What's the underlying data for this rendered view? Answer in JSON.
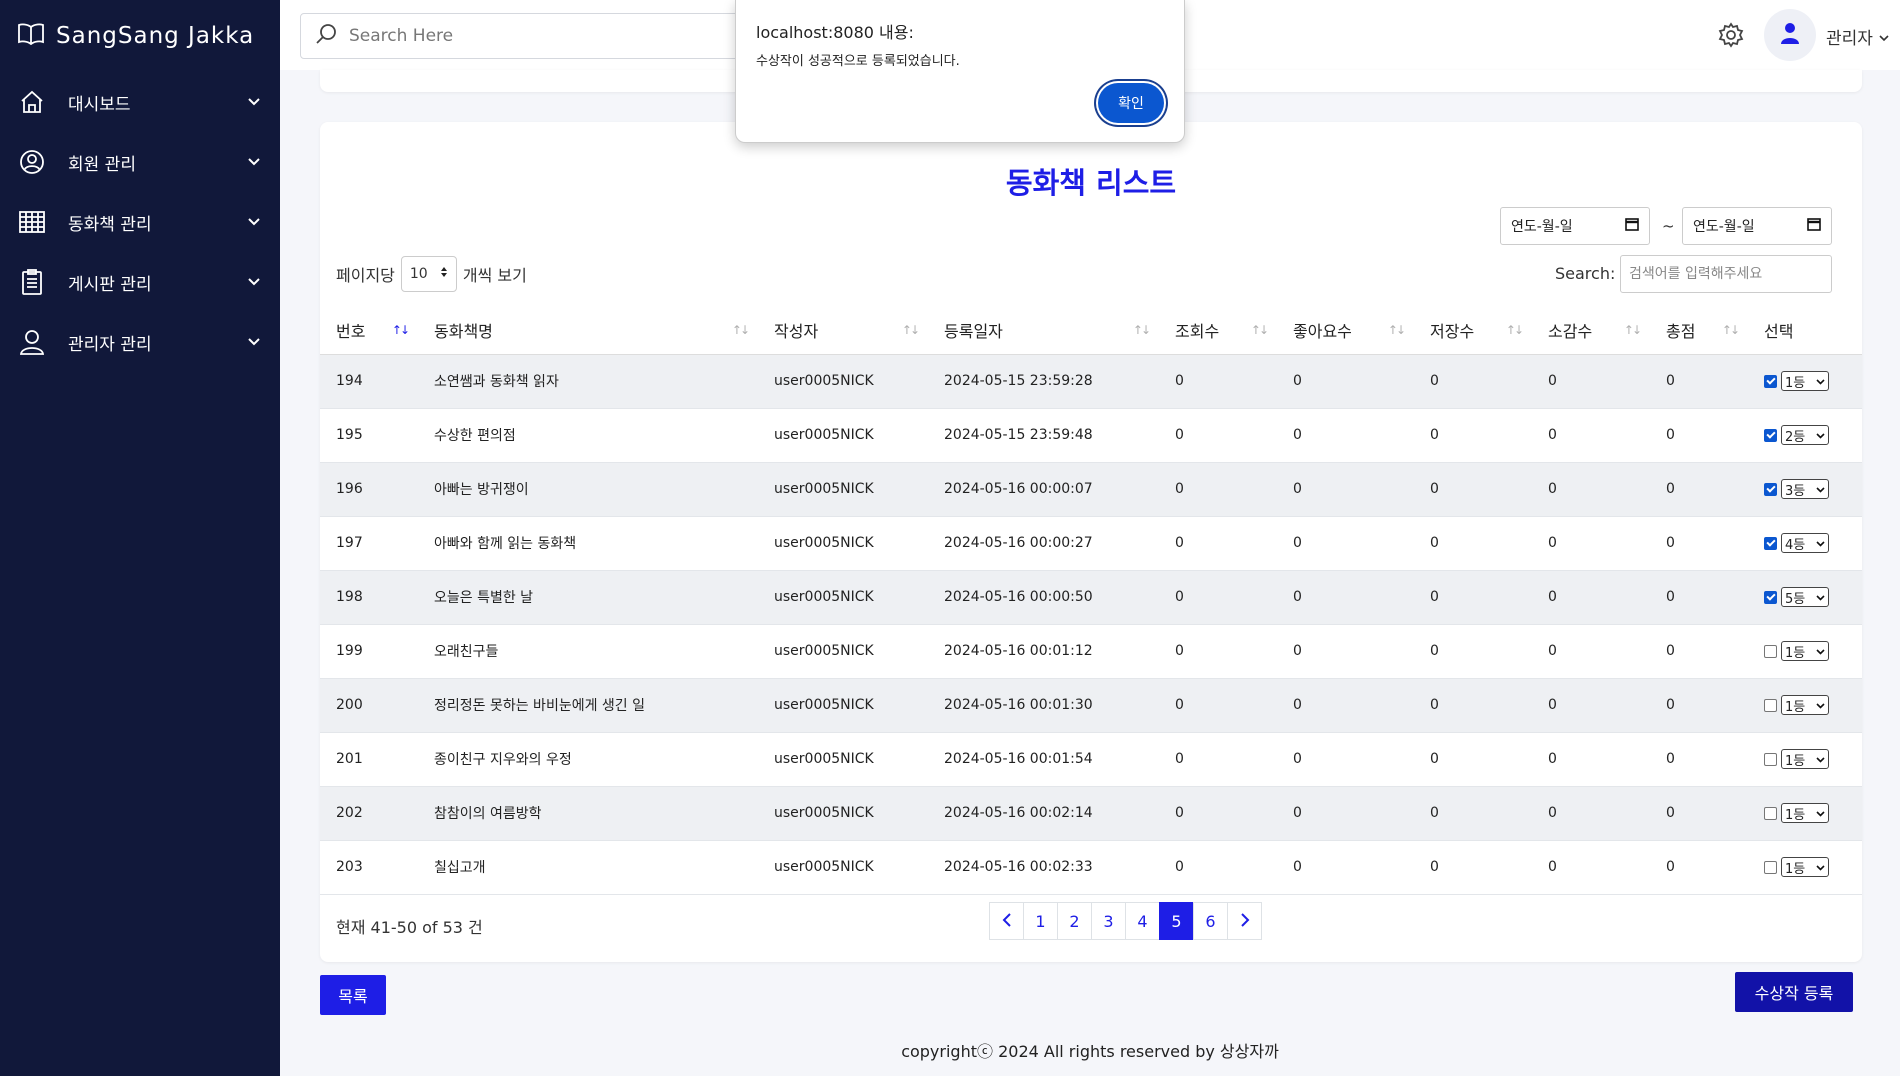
{
  "sidebar": {
    "brand": "SangSang Jakka",
    "items": [
      {
        "label": "대시보드",
        "icon": "home-icon"
      },
      {
        "label": "회원 관리",
        "icon": "user-circle-icon"
      },
      {
        "label": "동화책 관리",
        "icon": "table-icon"
      },
      {
        "label": "게시판 관리",
        "icon": "clipboard-icon"
      },
      {
        "label": "관리자 관리",
        "icon": "user-icon"
      }
    ]
  },
  "topbar": {
    "search_placeholder": "Search Here",
    "admin_name": "관리자"
  },
  "dialog": {
    "title": "localhost:8080 내용:",
    "message": "수상작이 성공적으로 등록되었습니다.",
    "confirm": "확인"
  },
  "main": {
    "title": "동화책 리스트",
    "date_placeholder_start": "연도-월-일",
    "date_placeholder_end": "연도-월-일",
    "tilde": "~",
    "per_page_prefix": "페이지당",
    "per_page_value": "10",
    "per_page_suffix": "개씩 보기",
    "search_label": "Search:",
    "search_placeholder": "검색어를 입력해주세요",
    "columns": [
      "번호",
      "동화책명",
      "작성자",
      "등록일자",
      "조회수",
      "좋아요수",
      "저장수",
      "소감수",
      "총점",
      "선택"
    ],
    "rows": [
      {
        "no": "194",
        "title": "소연쌤과 동화책 읽자",
        "author": "user0005NICK",
        "date": "2024-05-15 23:59:28",
        "views": "0",
        "likes": "0",
        "saves": "0",
        "reviews": "0",
        "score": "0",
        "checked": true,
        "rank": "1등"
      },
      {
        "no": "195",
        "title": "수상한 편의점",
        "author": "user0005NICK",
        "date": "2024-05-15 23:59:48",
        "views": "0",
        "likes": "0",
        "saves": "0",
        "reviews": "0",
        "score": "0",
        "checked": true,
        "rank": "2등"
      },
      {
        "no": "196",
        "title": "아빠는 방귀쟁이",
        "author": "user0005NICK",
        "date": "2024-05-16 00:00:07",
        "views": "0",
        "likes": "0",
        "saves": "0",
        "reviews": "0",
        "score": "0",
        "checked": true,
        "rank": "3등"
      },
      {
        "no": "197",
        "title": "아빠와 함께 읽는 동화책",
        "author": "user0005NICK",
        "date": "2024-05-16 00:00:27",
        "views": "0",
        "likes": "0",
        "saves": "0",
        "reviews": "0",
        "score": "0",
        "checked": true,
        "rank": "4등"
      },
      {
        "no": "198",
        "title": "오늘은 특별한 날",
        "author": "user0005NICK",
        "date": "2024-05-16 00:00:50",
        "views": "0",
        "likes": "0",
        "saves": "0",
        "reviews": "0",
        "score": "0",
        "checked": true,
        "rank": "5등"
      },
      {
        "no": "199",
        "title": "오래친구들",
        "author": "user0005NICK",
        "date": "2024-05-16 00:01:12",
        "views": "0",
        "likes": "0",
        "saves": "0",
        "reviews": "0",
        "score": "0",
        "checked": false,
        "rank": "1등"
      },
      {
        "no": "200",
        "title": "정리정돈 못하는 바비눈에게 생긴 일",
        "author": "user0005NICK",
        "date": "2024-05-16 00:01:30",
        "views": "0",
        "likes": "0",
        "saves": "0",
        "reviews": "0",
        "score": "0",
        "checked": false,
        "rank": "1등"
      },
      {
        "no": "201",
        "title": "종이친구 지우와의 우정",
        "author": "user0005NICK",
        "date": "2024-05-16 00:01:54",
        "views": "0",
        "likes": "0",
        "saves": "0",
        "reviews": "0",
        "score": "0",
        "checked": false,
        "rank": "1등"
      },
      {
        "no": "202",
        "title": "참참이의 여름방학",
        "author": "user0005NICK",
        "date": "2024-05-16 00:02:14",
        "views": "0",
        "likes": "0",
        "saves": "0",
        "reviews": "0",
        "score": "0",
        "checked": false,
        "rank": "1등"
      },
      {
        "no": "203",
        "title": "칠십고개",
        "author": "user0005NICK",
        "date": "2024-05-16 00:02:33",
        "views": "0",
        "likes": "0",
        "saves": "0",
        "reviews": "0",
        "score": "0",
        "checked": false,
        "rank": "1등"
      }
    ],
    "summary": "현재 41-50 of 53 건",
    "pages": [
      "1",
      "2",
      "3",
      "4",
      "5",
      "6"
    ],
    "active_page": "5"
  },
  "buttons": {
    "list": "목록",
    "register": "수상작 등록"
  },
  "footer": "copyrightⓒ 2024 All rights reserved by 상상자까",
  "colors": {
    "sidebar_bg": "#11183a",
    "accent": "#1e1ee6",
    "register_bg": "#1212a8",
    "dialog_button": "#0b57d0"
  }
}
